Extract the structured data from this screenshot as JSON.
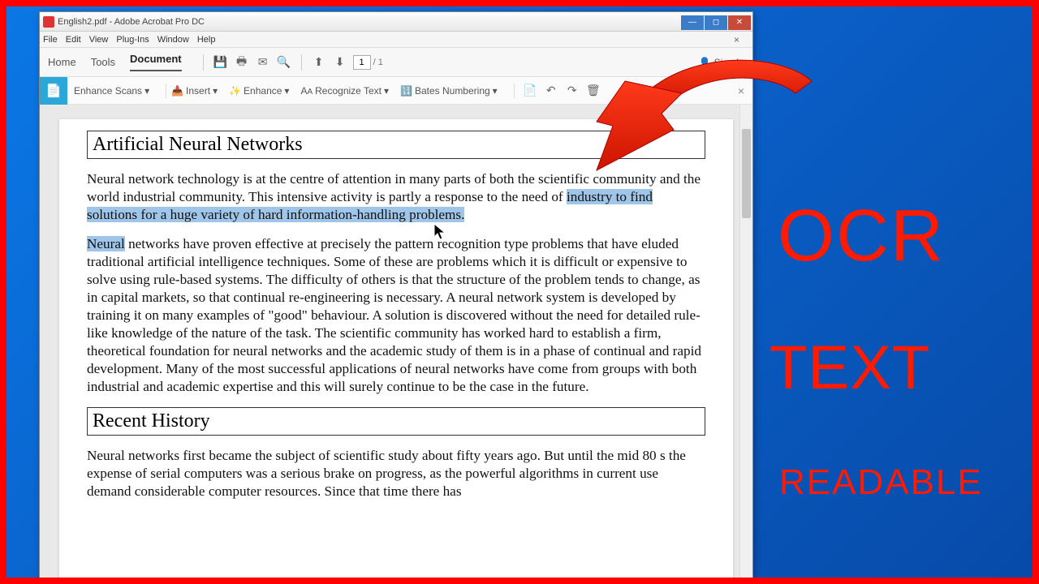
{
  "window": {
    "title": "English2.pdf - Adobe Acrobat Pro DC"
  },
  "menubar": [
    "File",
    "Edit",
    "View",
    "Plug-Ins",
    "Window",
    "Help"
  ],
  "tabs": {
    "home": "Home",
    "tools": "Tools",
    "document": "Document"
  },
  "page_nav": {
    "current": "1",
    "total": "/ 1"
  },
  "signin": "Sign In",
  "toolbar2": {
    "enhance_scans": "Enhance Scans",
    "insert": "Insert",
    "enhance": "Enhance",
    "recognize": "Recognize Text",
    "bates": "Bates Numbering"
  },
  "doc": {
    "title1": "Artificial Neural Networks",
    "p1a": "Neural network technology is at the centre of attention in many parts of both the scientific community and the world industrial community. This intensive activity is partly a response to the need of ",
    "p1b": "industry to find solutions for a huge variety of hard information-handling problems.",
    "p2a": "Neural",
    "p2b": " networks have proven effective at precisely the pattern recognition type problems that have eluded traditional artificial intelligence techniques. Some of these are problems which it is difficult or expensive to solve using rule-based systems. The difficulty of others is that the structure of the problem tends to change, as in capital markets, so that continual re-engineering is necessary. A neural network system is developed by training it on many examples of \"good\" behaviour. A solution is discovered without the need for detailed rule-like knowledge of the nature of the task. The scientific community has worked hard to establish a firm, theoretical foundation for neural networks and the academic study of them is in a phase of continual and rapid development. Many of the most successful applications of neural networks have come from groups with both industrial and academic expertise and this will surely continue to be the case in the future.",
    "title2": "Recent History",
    "p3": "Neural networks first became the subject of scientific study about fifty years ago. But until the mid  80 s the expense of serial computers was a serious brake on progress, as the powerful algorithms in current use demand considerable computer resources. Since that time there has"
  },
  "overlay": {
    "t1": "OCR",
    "t2": "TEXT",
    "t3": "READABLE"
  }
}
